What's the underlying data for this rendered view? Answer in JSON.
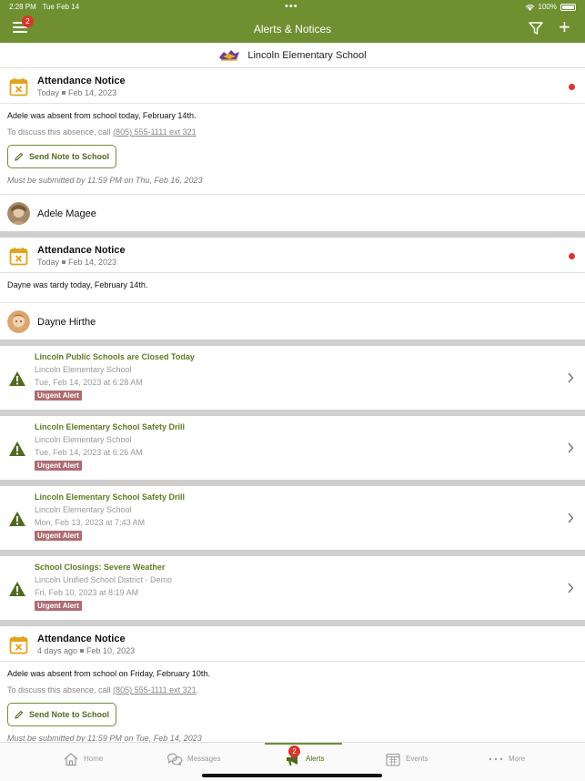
{
  "status_bar": {
    "time": "2:28 PM",
    "date": "Tue Feb 14",
    "battery": "100%"
  },
  "nav": {
    "title": "Alerts & Notices",
    "menu_badge": "2"
  },
  "school": {
    "name": "Lincoln Elementary School"
  },
  "attendance": [
    {
      "title": "Attendance Notice",
      "when": "Today",
      "date": "Feb 14, 2023",
      "message": "Adele was absent from school today, February 14th.",
      "call_prefix": "To discuss this absence, call ",
      "phone": "(805) 555-1111 ext 321",
      "call_suffix": "",
      "button": "Send Note to School",
      "deadline": "Must be submitted by 11:59 PM on Thu, Feb 16, 2023",
      "student": "Adele Magee",
      "unread": true
    },
    {
      "title": "Attendance Notice",
      "when": "Today",
      "date": "Feb 14, 2023",
      "message": "Dayne was tardy today, February 14th.",
      "student": "Dayne Hirthe",
      "unread": true
    },
    {
      "title": "Attendance Notice",
      "when": "4 days ago",
      "date": "Feb 10, 2023",
      "message": "Adele was absent from school on Friday, February 10th.",
      "call_prefix": "To discuss this absence, call ",
      "phone": "(805) 555-1111 ext 321",
      "call_suffix": ".",
      "button": "Send Note to School",
      "deadline": "Must be submitted by 11:59 PM on Tue, Feb 14, 2023"
    }
  ],
  "alerts": [
    {
      "title": "Lincoln Public Schools are Closed Today",
      "source": "Lincoln Elementary School",
      "datetime": "Tue, Feb 14, 2023 at 6:28 AM",
      "tag": "Urgent Alert"
    },
    {
      "title": "Lincoln Elementary School Safety Drill",
      "source": "Lincoln Elementary School",
      "datetime": "Tue, Feb 14, 2023 at 6:26 AM",
      "tag": "Urgent Alert"
    },
    {
      "title": "Lincoln Elementary School Safety Drill",
      "source": "Lincoln Elementary School",
      "datetime": "Mon, Feb 13, 2023 at 7:43 AM",
      "tag": "Urgent Alert"
    },
    {
      "title": "School Closings: Severe Weather",
      "source": "Lincoln Unified School District - Demo",
      "datetime": "Fri, Feb 10, 2023 at 8:19 AM",
      "tag": "Urgent Alert"
    }
  ],
  "tabs": [
    {
      "label": "Home",
      "icon": "home-icon"
    },
    {
      "label": "Messages",
      "icon": "messages-icon"
    },
    {
      "label": "Alerts",
      "icon": "megaphone-icon",
      "badge": "2",
      "active": true
    },
    {
      "label": "Events",
      "icon": "calendar-icon"
    },
    {
      "label": "More",
      "icon": "more-icon"
    }
  ],
  "colors": {
    "brand": "#6f8f31",
    "alert_title": "#5b7e22",
    "urgent_tag": "#b06b70",
    "unread_dot": "#d9352c"
  }
}
